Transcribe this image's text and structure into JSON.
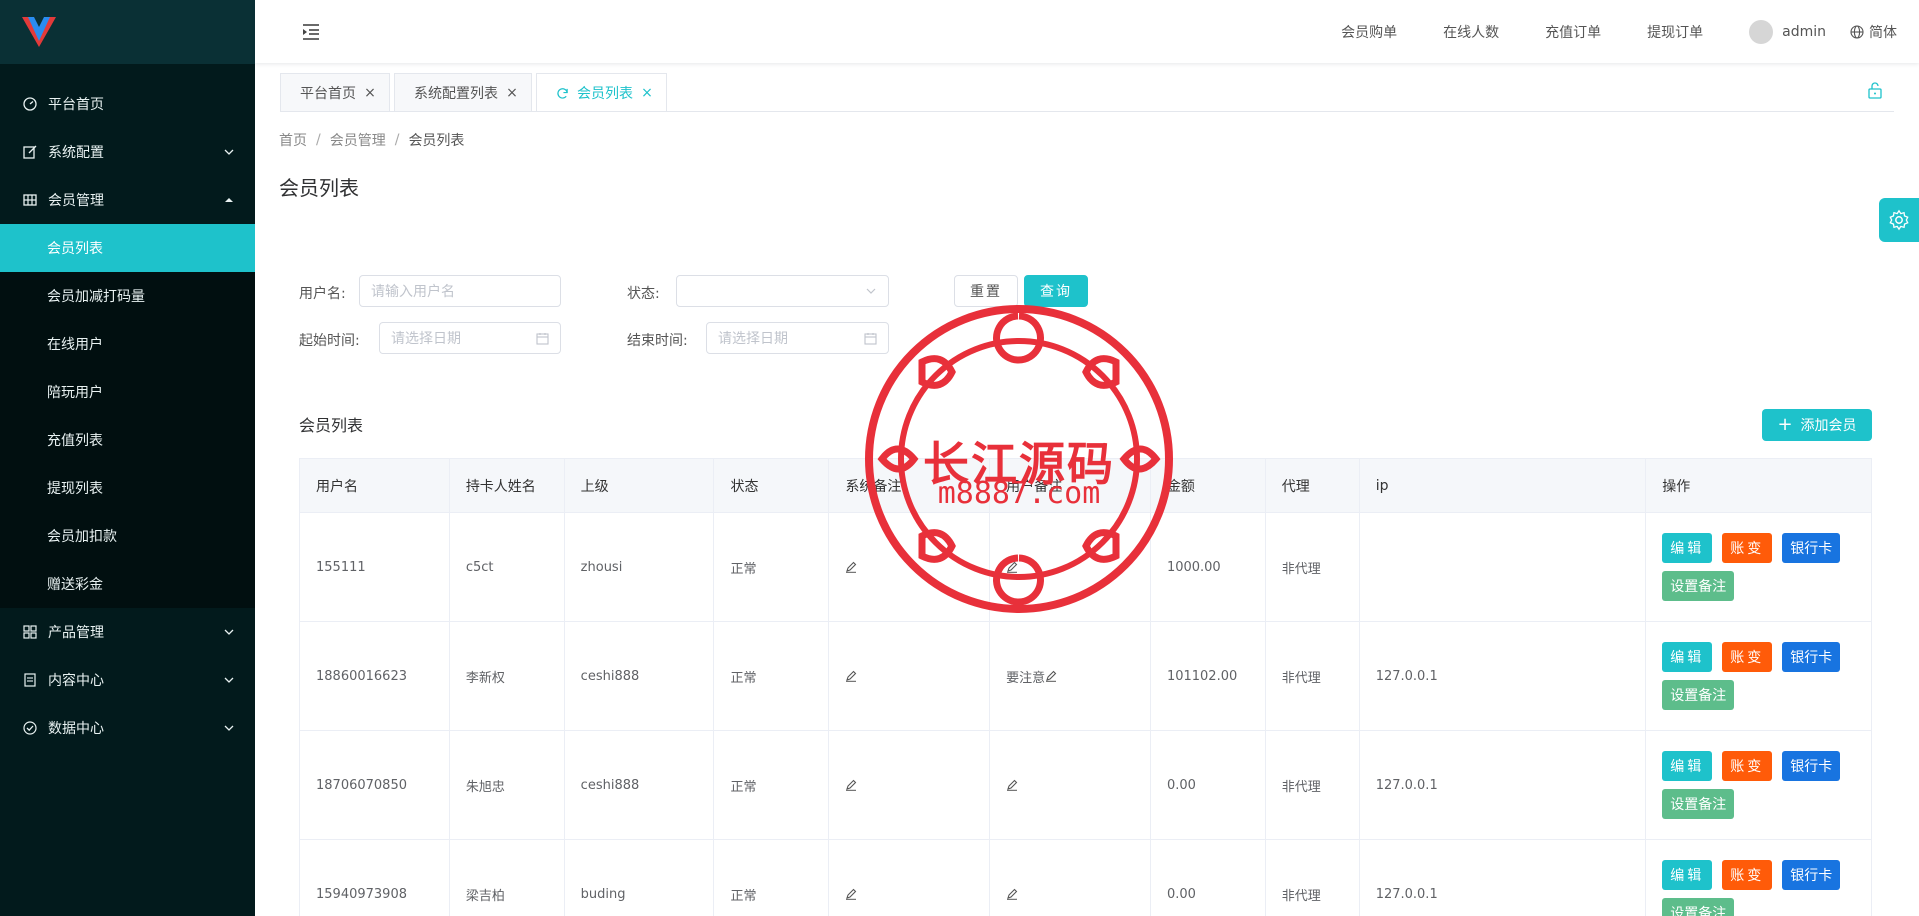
{
  "sidebar": {
    "items": [
      {
        "label": "平台首页",
        "icon": "dashboard-icon"
      },
      {
        "label": "系统配置",
        "icon": "edit-icon"
      },
      {
        "label": "会员管理",
        "icon": "grid-icon"
      },
      {
        "label": "产品管理",
        "icon": "apps-icon"
      },
      {
        "label": "内容中心",
        "icon": "document-icon"
      },
      {
        "label": "数据中心",
        "icon": "check-circle-icon"
      }
    ],
    "submenu": [
      {
        "label": "会员列表",
        "active": true
      },
      {
        "label": "会员加减打码量"
      },
      {
        "label": "在线用户"
      },
      {
        "label": "陪玩用户"
      },
      {
        "label": "充值列表"
      },
      {
        "label": "提现列表"
      },
      {
        "label": "会员加扣款"
      },
      {
        "label": "赠送彩金"
      }
    ]
  },
  "header": {
    "links": [
      "会员购单",
      "在线人数",
      "充值订单",
      "提现订单"
    ],
    "username": "admin",
    "language": "简体"
  },
  "tabs": [
    {
      "label": "平台首页"
    },
    {
      "label": "系统配置列表"
    },
    {
      "label": "会员列表",
      "active": true
    }
  ],
  "breadcrumb": [
    "首页",
    "会员管理",
    "会员列表"
  ],
  "page_title": "会员列表",
  "filters": {
    "username_label": "用户名:",
    "username_placeholder": "请输入用户名",
    "status_label": "状态:",
    "start_label": "起始时间:",
    "start_placeholder": "请选择日期",
    "end_label": "结束时间:",
    "end_placeholder": "请选择日期",
    "reset_label": "重置",
    "query_label": "查询"
  },
  "section": {
    "title": "会员列表",
    "add_label": "添加会员"
  },
  "table": {
    "columns": [
      "用户名",
      "持卡人姓名",
      "上级",
      "状态",
      "系统备注",
      "用户备注",
      "金额",
      "代理",
      "ip",
      "操作"
    ],
    "rows": [
      {
        "username": "155111",
        "cardholder": "c5ct",
        "parent": "zhousi",
        "status": "正常",
        "sys_note": "",
        "user_note": "",
        "amount": "1000.00",
        "agent": "非代理",
        "ip": ""
      },
      {
        "username": "18860016623",
        "cardholder": "李新权",
        "parent": "ceshi888",
        "status": "正常",
        "sys_note": "",
        "user_note": "要注意",
        "amount": "101102.00",
        "agent": "非代理",
        "ip": "127.0.0.1"
      },
      {
        "username": "18706070850",
        "cardholder": "朱旭忠",
        "parent": "ceshi888",
        "status": "正常",
        "sys_note": "",
        "user_note": "",
        "amount": "0.00",
        "agent": "非代理",
        "ip": "127.0.0.1"
      },
      {
        "username": "15940973908",
        "cardholder": "梁吉柏",
        "parent": "buding",
        "status": "正常",
        "sys_note": "",
        "user_note": "",
        "amount": "0.00",
        "agent": "非代理",
        "ip": "127.0.0.1"
      }
    ],
    "actions": {
      "edit": "编辑",
      "change": "账变",
      "bank": "银行卡",
      "note": "设置备注"
    }
  },
  "watermark": {
    "title": "长江源码",
    "url": "m8887.com"
  },
  "colors": {
    "accent": "#1ec2cb",
    "sidebar_bg": "#021a1c",
    "orange": "#ff5b09",
    "blue": "#1874e0",
    "green": "#5dbd8b",
    "watermark": "#e8303a"
  }
}
